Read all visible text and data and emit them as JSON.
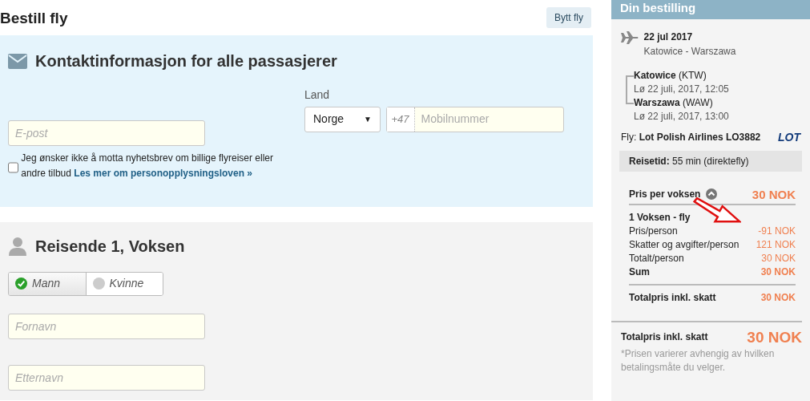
{
  "page_title": "Bestill fly",
  "change_button": "Bytt fly",
  "contact": {
    "heading": "Kontaktinformasjon for alle passasjerer",
    "email_placeholder": "E-post",
    "country_label": "Land",
    "country_value": "Norge",
    "country_caret": "▼",
    "phone_prefix": "+47",
    "phone_placeholder": "Mobilnummer",
    "newsletter_checked": false,
    "newsletter_text": "Jeg ønsker ikke å motta nyhetsbrev om billige flyreiser eller andre tilbud",
    "privacy_link": "Les mer om personopplysningsloven »"
  },
  "traveller": {
    "heading": "Reisende 1, Voksen",
    "genders": [
      {
        "label": "Mann",
        "selected": true
      },
      {
        "label": "Kvinne",
        "selected": false
      }
    ],
    "first_name_placeholder": "Fornavn",
    "last_name_placeholder": "Etternavn"
  },
  "summary": {
    "title": "Din bestilling",
    "date": "22 jul 2017",
    "route": "Katowice - Warszawa",
    "stops": [
      {
        "city": "Katowice",
        "code": "(KTW)",
        "time": "Lø 22 juli, 2017, 12:05"
      },
      {
        "city": "Warszawa",
        "code": "(WAW)",
        "time": "Lø 22 juli, 2017, 13:00"
      }
    ],
    "flight_label": "Fly:",
    "flight": "Lot Polish Airlines LO3882",
    "airline_logo": "LOT",
    "duration_label": "Reisetid:",
    "duration": "55 min (direktefly)",
    "price_per_adult_label": "Pris per voksen",
    "price_per_adult": "30 NOK",
    "expanded": true,
    "group_title": "1 Voksen - fly",
    "rows": [
      {
        "label": "Pris/person",
        "value": "-91 NOK",
        "strong": false
      },
      {
        "label": "Skatter og avgifter/person",
        "value": "121 NOK",
        "strong": false
      },
      {
        "label": "Totalt/person",
        "value": "30 NOK",
        "strong": false
      },
      {
        "label": "Sum",
        "value": "30 NOK",
        "strong": true
      }
    ],
    "subtotal_label": "Totalpris inkl. skatt",
    "subtotal": "30 NOK",
    "total_label": "Totalpris inkl. skatt",
    "total": "30 NOK",
    "note": "*Prisen varierer avhengig av hvilken betalingsmåte du velger."
  }
}
